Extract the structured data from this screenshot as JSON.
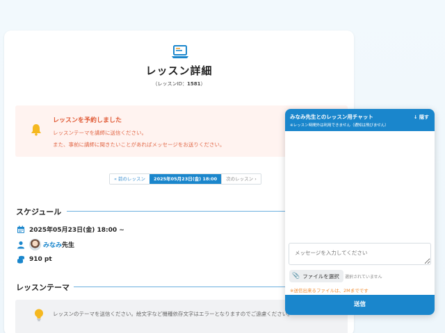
{
  "page": {
    "title": "レッスン詳細",
    "lesson_id_label": "（レッスンID：",
    "lesson_id": "1581",
    "lesson_id_suffix": "）"
  },
  "notice": {
    "title": "レッスンを予約しました",
    "line1": "レッスンテーマを講師に送信ください。",
    "line2": "また、事前に講師に聞きたいことがあればメッセージをお送りください。"
  },
  "pager": {
    "prev": "« 前のレッスン",
    "current": "2025年05月23日(金) 18:00",
    "next": "次のレッスン ›"
  },
  "schedule": {
    "title": "スケジュール",
    "datetime": "2025年05月23日(金) 18:00 ~",
    "teacher_name": "みなみ",
    "teacher_suffix": " 先生",
    "points": "910 pt"
  },
  "theme": {
    "title": "レッスンテーマ",
    "message": "レッスンのテーマを送信ください。絵文字など機種依存文字はエラーとなりますのでご遠慮ください。"
  },
  "chat": {
    "title": "みなみ先生とのレッスン用チャット",
    "subtitle": "※レッスン時間外は利用できません（通知は飛びません）",
    "hide": "↓ 隠す",
    "input_placeholder": "メッセージを入力してください",
    "file_button": "ファイルを選択",
    "file_none": "選択されていません",
    "file_limit": "※送信出来るファイルは、2Mまでです",
    "send": "送信"
  },
  "colors": {
    "primary": "#1a86cc",
    "notice_bg": "#fff3f0",
    "notice_text": "#e15c38",
    "warning": "#f08a2e"
  }
}
